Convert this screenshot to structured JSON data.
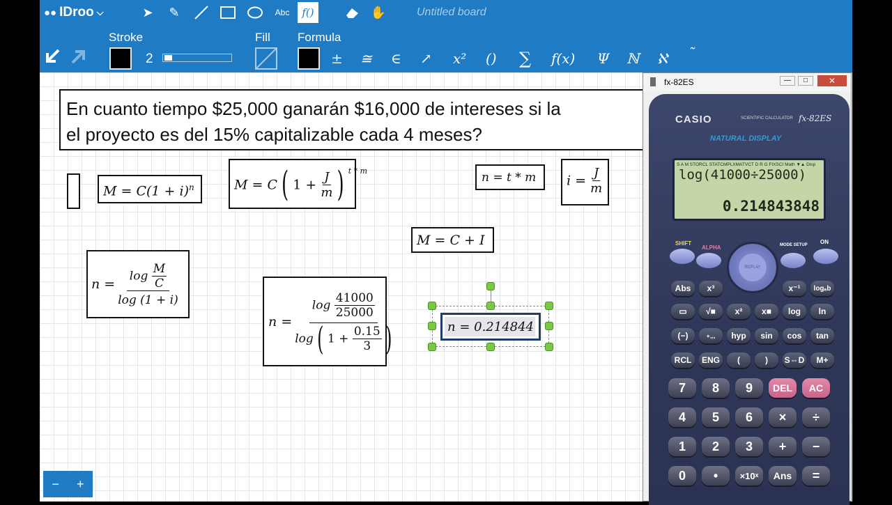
{
  "toolbar": {
    "app_name": "IDroo",
    "board_title": "Untitled board",
    "stroke_label": "Stroke",
    "stroke_width": "2",
    "fill_label": "Fill",
    "formula_label": "Formula",
    "text_tool_label": "Abc",
    "formula_tool_label": "f()",
    "math_symbols": [
      "±",
      "≅",
      "∈",
      "↗",
      "x²",
      "()",
      "∑",
      "f(x)",
      "Ψ",
      "ℕ",
      "ℵ",
      "˜"
    ]
  },
  "canvas": {
    "problem_line1": "En cuanto tiempo $25,000 ganarán $16,000 de intereses si la",
    "problem_line2": "el proyecto es del 15% capitalizable cada 4 meses?",
    "f_compound": "M = C(1 + i)",
    "f_compound_exp": "n",
    "f_M_prefix": "M = C",
    "f_one_plus": "1 +",
    "f_J": "J",
    "f_m": "m",
    "f_exp2": "t * m",
    "f_n_tm": "n = t * m",
    "f_i_prefix": "i =",
    "f_M_sum": "M = C + I",
    "f_n_prefix": "n =",
    "f_log": "log",
    "f_M": "M",
    "f_C": "C",
    "f_log_den": "log (1 + i)",
    "v_41000": "41000",
    "v_25000": "25000",
    "v_015": "0.15",
    "v_3": "3",
    "result_text": "n = 0.214844",
    "zoom_minus": "−",
    "zoom_plus": "+"
  },
  "calculator": {
    "window_title": "fx-82ES",
    "brand": "CASIO",
    "subtitle": "SCIENTIFIC CALCULATOR",
    "model": "fx-82ES",
    "natural_display": "NATURAL DISPLAY",
    "status_line": "S A M STORCL STATCMPLXMATVCT D R G FIXSCI Math ▼▲ Disp",
    "expression": "log(41000÷25000)",
    "result": "0.214843848",
    "top_labels": {
      "shift": "SHIFT",
      "alpha": "ALPHA",
      "replay": "REPLAY",
      "mode": "MODE SETUP",
      "on": "ON"
    },
    "row1": [
      "Abs",
      "x³",
      "x⁻¹",
      "logₐb"
    ],
    "row2": [
      "▭",
      "√■",
      "x²",
      "x■",
      "log",
      "ln"
    ],
    "row3": [
      "(−)",
      "∘‚‚‚",
      "hyp",
      "sin",
      "cos",
      "tan"
    ],
    "row4": [
      "RCL",
      "ENG",
      "(",
      ")",
      "S⇔D",
      "M+"
    ],
    "digits1": [
      "7",
      "8",
      "9",
      "DEL",
      "AC"
    ],
    "digits2": [
      "4",
      "5",
      "6",
      "×",
      "÷"
    ],
    "digits3": [
      "1",
      "2",
      "3",
      "+",
      "−"
    ],
    "digits4": [
      "0",
      "•",
      "×10ˣ",
      "Ans",
      "="
    ]
  }
}
